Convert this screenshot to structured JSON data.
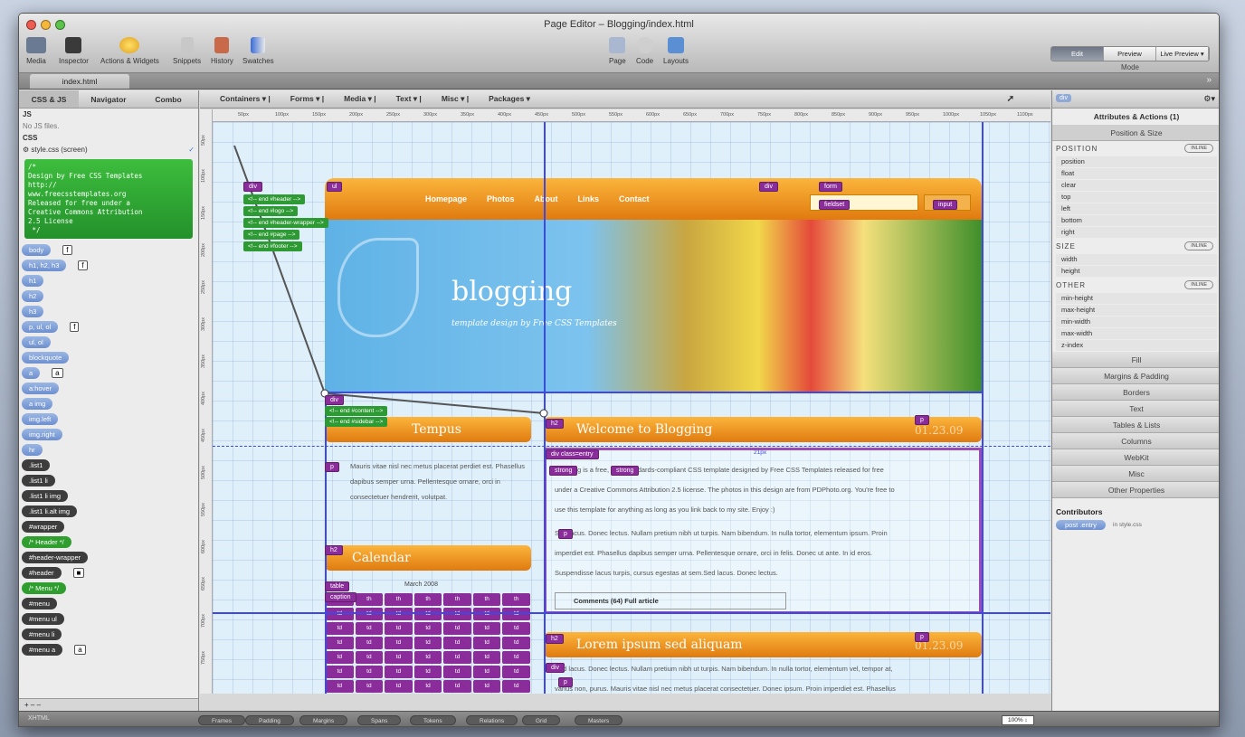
{
  "window": {
    "title": "Page Editor – Blogging/index.html"
  },
  "toolbar": {
    "left_items": [
      "Media",
      "Inspector",
      "Actions & Widgets",
      "Snippets",
      "History",
      "Swatches"
    ],
    "center_items": [
      "Page",
      "Code",
      "Layouts"
    ],
    "mode_buttons": [
      "Edit",
      "Preview",
      "Live Preview ▾"
    ],
    "mode_label": "Mode"
  },
  "document_tab": "index.html",
  "left_panel": {
    "tabs": [
      "CSS & JS",
      "Navigator",
      "Combo"
    ],
    "js_heading": "JS",
    "js_empty": "No JS files.",
    "css_heading": "CSS",
    "stylesheet": "style.css (screen)",
    "comment_block": "/*\nDesign by Free CSS Templates\nhttp://\nwww.freecsstemplates.org\nReleased for free under a\nCreative Commons Attribution\n2.5 License\n */",
    "selectors": [
      {
        "label": "body",
        "style": "blue",
        "chip": "f"
      },
      {
        "label": "h1, h2, h3",
        "style": "blue",
        "chip": "f"
      },
      {
        "label": "h1",
        "style": "blue",
        "chip": ""
      },
      {
        "label": "h2",
        "style": "blue",
        "chip": ""
      },
      {
        "label": "h3",
        "style": "blue",
        "chip": ""
      },
      {
        "label": "p, ul, ol",
        "style": "blue",
        "chip": "f"
      },
      {
        "label": "ul, ol",
        "style": "blue",
        "chip": ""
      },
      {
        "label": "blockquote",
        "style": "blue",
        "chip": ""
      },
      {
        "label": "a",
        "style": "blue",
        "chip": "a"
      },
      {
        "label": "a:hover",
        "style": "blue",
        "chip": ""
      },
      {
        "label": "a img",
        "style": "blue",
        "chip": ""
      },
      {
        "label": "img.left",
        "style": "blue",
        "chip": ""
      },
      {
        "label": "img.right",
        "style": "blue",
        "chip": ""
      },
      {
        "label": "hr",
        "style": "blue",
        "chip": ""
      },
      {
        "label": ".list1",
        "style": "dark",
        "chip": ""
      },
      {
        "label": ".list1 li",
        "style": "dark",
        "chip": ""
      },
      {
        "label": ".list1 li img",
        "style": "dark",
        "chip": ""
      },
      {
        "label": ".list1 li.alt img",
        "style": "dark",
        "chip": ""
      },
      {
        "label": "#wrapper",
        "style": "dark",
        "chip": ""
      },
      {
        "label": "/* Header */",
        "style": "green",
        "chip": ""
      },
      {
        "label": "#header-wrapper",
        "style": "dark",
        "chip": ""
      },
      {
        "label": "#header",
        "style": "dark",
        "chip": "■"
      },
      {
        "label": "/* Menu */",
        "style": "green",
        "chip": ""
      },
      {
        "label": "#menu",
        "style": "dark",
        "chip": ""
      },
      {
        "label": "#menu ul",
        "style": "dark",
        "chip": ""
      },
      {
        "label": "#menu li",
        "style": "dark",
        "chip": ""
      },
      {
        "label": "#menu a",
        "style": "dark",
        "chip": "a"
      }
    ],
    "footer_controls": "+ – –",
    "xhtml_label": "XHTML"
  },
  "canvas_toolbar": {
    "menus": [
      "Containers ▾ |",
      "Forms ▾ |",
      "Media ▾ |",
      "Text ▾ |",
      "Misc ▾ |",
      "Packages ▾"
    ]
  },
  "ruler": {
    "h_marks": [
      "50px",
      "100px",
      "150px",
      "200px",
      "250px",
      "300px",
      "350px",
      "400px",
      "450px",
      "500px",
      "550px",
      "600px",
      "650px",
      "700px",
      "750px",
      "800px",
      "850px",
      "900px",
      "950px",
      "1000px",
      "1050px",
      "1100px"
    ],
    "v_marks": [
      "50px",
      "100px",
      "150px",
      "200px",
      "250px",
      "300px",
      "350px",
      "400px",
      "450px",
      "500px",
      "550px",
      "600px",
      "650px",
      "700px",
      "750px"
    ]
  },
  "page": {
    "logo": "blogging",
    "tagline": "template design by Free CSS Templates",
    "nav": [
      "Homepage",
      "Photos",
      "About",
      "Links",
      "Contact"
    ],
    "sidebar_title_1": "Tempus",
    "sidebar_text": "Mauris vitae nisl nec metus placerat perdiet est. Phasellus dapibus semper urna. Pellentesque ornare, orci in consectetuer hendrerit, volutpat.",
    "calendar_title": "Calendar",
    "calendar_caption": "March 2008",
    "post1": {
      "title": "Welcome to Blogging",
      "date": "01.23.09",
      "meta": "21px",
      "line1": "Blogging is a free, fully standards-compliant CSS template designed by Free CSS Templates released for free",
      "line2": "under a Creative Commons Attribution 2.5 license. The photos in this design are from PDPhoto.org. You're free to",
      "line3": "use this template for anything as long as you link back to my site. Enjoy :)",
      "line4": "Sed lacus. Donec lectus. Nullam pretium nibh ut turpis. Nam bibendum. In nulla tortor, elementum ipsum. Proin",
      "line5": "imperdiet est. Phasellus dapibus semper urna. Pellentesque ornare, orci in felis. Donec ut ante. In id eros.",
      "line6": "Suspendisse lacus turpis, cursus egestas at sem.Sed lacus. Donec lectus.",
      "links": "Comments (64)   Full article"
    },
    "post2": {
      "title": "Lorem ipsum sed aliquam",
      "date": "01.23.09",
      "line1": "Sed lacus. Donec lectus. Nullam pretium nibh ut turpis. Nam bibendum. In nulla tortor, elementum vel, tempor at,",
      "line2": "varius non, purus. Mauris vitae nisl nec metus placerat consectetuer. Donec ipsum. Proin imperdiet est. Phasellus"
    },
    "tags": {
      "div": "div",
      "ul": "ul",
      "form": "form",
      "fieldset": "fieldset",
      "input": "input",
      "p": "p",
      "h2": "h2",
      "table": "table",
      "caption": "caption",
      "tr": "tr",
      "td": "td",
      "th": "th",
      "strong": "strong",
      "divclass": "div class=entry"
    },
    "comments": [
      "<!-- end #header -->",
      "<!-- end #logo -->",
      "<!-- end #header-wrapper -->",
      "<!-- end #page -->",
      "<!-- end #footer -->",
      "<!-- end #content -->",
      "<!-- end #sidebar -->"
    ]
  },
  "right_panel": {
    "element_badge": "div",
    "title": "Attributes & Actions (1)",
    "subtitle": "Position & Size",
    "position_heading": "POSITION",
    "size_heading": "SIZE",
    "other_heading": "OTHER",
    "inline_label": "INLINE",
    "position_props": [
      "position",
      "float",
      "clear",
      "top",
      "left",
      "bottom",
      "right"
    ],
    "size_props": [
      "width",
      "height"
    ],
    "other_props": [
      "min-height",
      "max-height",
      "min-width",
      "max-width",
      "z-index"
    ],
    "categories": [
      "Fill",
      "Margins & Padding",
      "Borders",
      "Text",
      "Tables & Lists",
      "Columns",
      "WebKit",
      "Misc",
      "Other Properties"
    ],
    "contributors_heading": "Contributors",
    "contributor_selector": "post .entry",
    "contributor_source": "in style.css"
  },
  "bottom_bar": {
    "buttons": [
      "Frames",
      "Padding",
      "Margins",
      "Spans",
      "Tokens",
      "Relations",
      "Grid",
      "Masters"
    ],
    "zoom": "100% ↕"
  },
  "colors": {
    "accent_orange": "#f29422",
    "tag_purple": "#8a2c9a",
    "guide_blue": "#3d48e6",
    "css_green": "#2f9e2f"
  }
}
